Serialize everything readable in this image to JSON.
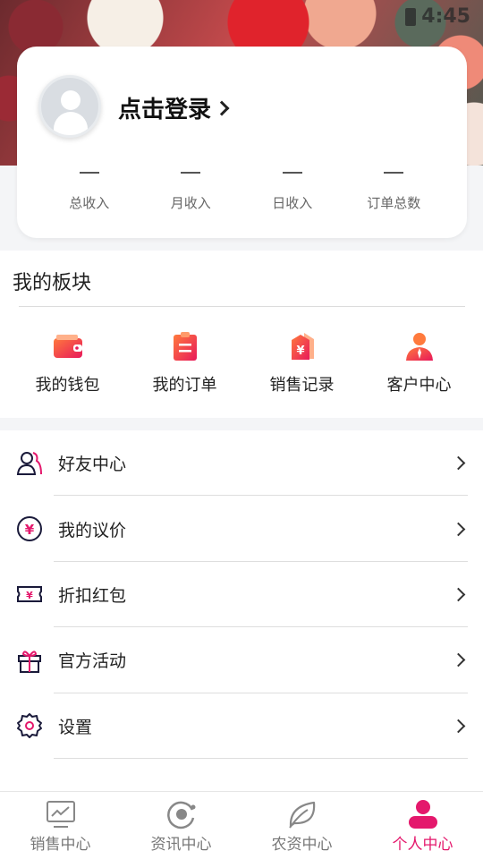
{
  "status": {
    "time": "4:45"
  },
  "profile": {
    "login_text": "点击登录",
    "stats": [
      {
        "value": "—",
        "label": "总收入"
      },
      {
        "value": "—",
        "label": "月收入"
      },
      {
        "value": "—",
        "label": "日收入"
      },
      {
        "value": "—",
        "label": "订单总数"
      }
    ]
  },
  "modules": {
    "title": "我的板块",
    "items": [
      {
        "label": "我的钱包",
        "icon": "wallet-icon"
      },
      {
        "label": "我的订单",
        "icon": "order-icon"
      },
      {
        "label": "销售记录",
        "icon": "sales-record-icon"
      },
      {
        "label": "客户中心",
        "icon": "customer-icon"
      }
    ]
  },
  "menu": [
    {
      "label": "好友中心",
      "icon": "friends-icon"
    },
    {
      "label": "我的议价",
      "icon": "yuan-circle-icon"
    },
    {
      "label": "折扣红包",
      "icon": "coupon-icon"
    },
    {
      "label": "官方活动",
      "icon": "gift-icon"
    },
    {
      "label": "设置",
      "icon": "gear-icon"
    }
  ],
  "tabbar": [
    {
      "label": "销售中心",
      "icon": "monitor-chart-icon",
      "active": false
    },
    {
      "label": "资讯中心",
      "icon": "orbit-icon",
      "active": false
    },
    {
      "label": "农资中心",
      "icon": "leaf-icon",
      "active": false
    },
    {
      "label": "个人中心",
      "icon": "person-icon",
      "active": true
    }
  ],
  "colors": {
    "accent": "#e4186c",
    "icon_gradient_start": "#ff6a3d",
    "icon_gradient_end": "#e8195a"
  }
}
